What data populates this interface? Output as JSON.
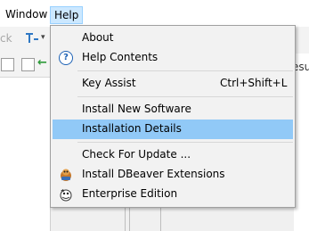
{
  "menubar": {
    "window_label": "Window",
    "help_label": "Help"
  },
  "toolbar": {
    "partial_text": "ck"
  },
  "background": {
    "partial_tab_text": "esu"
  },
  "help_menu": {
    "items": [
      {
        "label": "About",
        "accel": "",
        "icon": ""
      },
      {
        "label": "Help Contents",
        "accel": "",
        "icon": "help-icon"
      },
      {
        "label": "Key Assist",
        "accel": "Ctrl+Shift+L",
        "icon": ""
      },
      {
        "label": "Install New Software",
        "accel": "",
        "icon": ""
      },
      {
        "label": "Installation Details",
        "accel": "",
        "icon": "",
        "selected": true
      },
      {
        "label": "Check For Update ...",
        "accel": "",
        "icon": ""
      },
      {
        "label": "Install DBeaver Extensions",
        "accel": "",
        "icon": "dbeaver-extensions-icon"
      },
      {
        "label": "Enterprise Edition",
        "accel": "",
        "icon": "enterprise-edition-icon"
      }
    ],
    "help_icon_glyph": "?"
  },
  "colors": {
    "selection": "#91c9f7",
    "menubar_highlight": "#cce8ff",
    "menu_bg": "#f2f2f2"
  }
}
